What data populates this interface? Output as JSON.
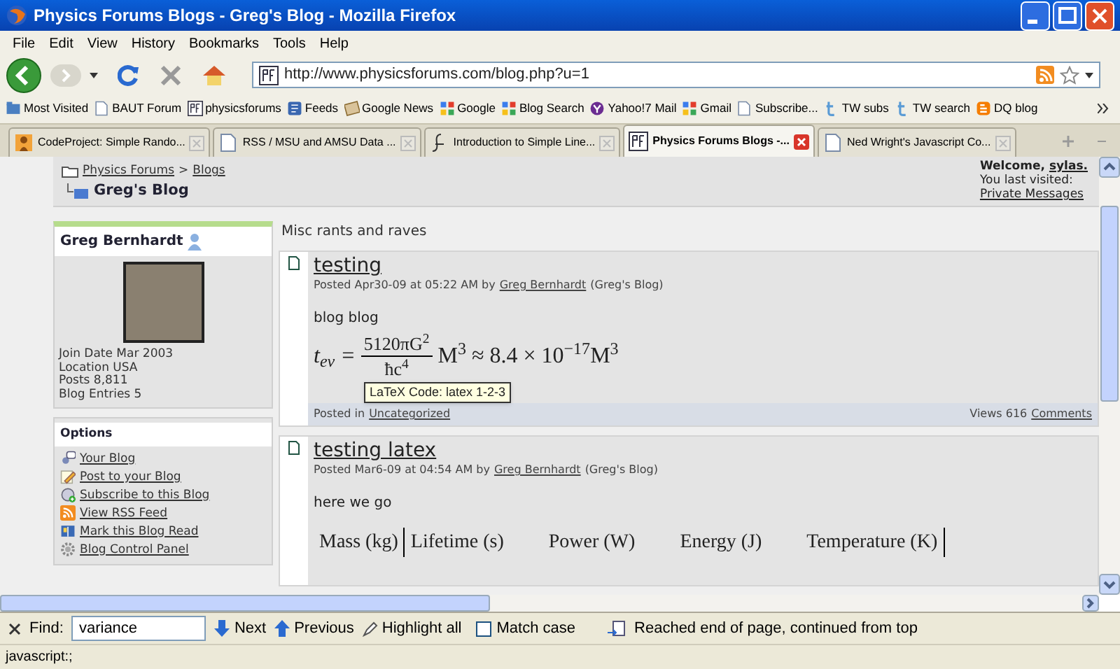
{
  "window": {
    "title": "Physics Forums Blogs - Greg's Blog - Mozilla Firefox"
  },
  "menu": [
    "File",
    "Edit",
    "View",
    "History",
    "Bookmarks",
    "Tools",
    "Help"
  ],
  "address": {
    "url": "http://www.physicsforums.com/blog.php?u=1"
  },
  "bookmarks": [
    {
      "label": "Most Visited",
      "kind": "folder"
    },
    {
      "label": "BAUT Forum",
      "kind": "page"
    },
    {
      "label": "physicsforums",
      "kind": "pf"
    },
    {
      "label": "Feeds",
      "kind": "feed"
    },
    {
      "label": "Google News",
      "kind": "news"
    },
    {
      "label": "Google",
      "kind": "google"
    },
    {
      "label": "Blog Search",
      "kind": "google"
    },
    {
      "label": "Yahoo!7 Mail",
      "kind": "yahoo"
    },
    {
      "label": "Gmail",
      "kind": "google"
    },
    {
      "label": "Subscribe...",
      "kind": "page"
    },
    {
      "label": "TW subs",
      "kind": "twitter"
    },
    {
      "label": "TW search",
      "kind": "twitter"
    },
    {
      "label": "DQ blog",
      "kind": "blogger"
    }
  ],
  "tabs": [
    {
      "label": "CodeProject: Simple Rando...",
      "selected": false,
      "kind": "codeproject"
    },
    {
      "label": "RSS / MSU and AMSU Data ...",
      "selected": false,
      "kind": "page"
    },
    {
      "label": "Introduction to Simple Line...",
      "selected": false,
      "kind": "script"
    },
    {
      "label": "Physics Forums Blogs -...",
      "selected": true,
      "kind": "pf"
    },
    {
      "label": "Ned Wright's Javascript Co...",
      "selected": false,
      "kind": "page"
    }
  ],
  "page": {
    "breadcrumb": {
      "root": "Physics Forums",
      "separator": ">",
      "section": "Blogs",
      "title": "Greg's Blog"
    },
    "welcome": {
      "label": "Welcome,",
      "user": "sylas.",
      "last_visited": "You last visited:",
      "private_messages": "Private Messages"
    },
    "profile": {
      "name": "Greg Bernhardt",
      "details": [
        "Join Date Mar 2003",
        "Location USA",
        "Posts 8,811",
        "Blog Entries 5"
      ]
    },
    "options": {
      "heading": "Options",
      "items": [
        {
          "label": "Your Blog",
          "kind": "blog"
        },
        {
          "label": "Post to your Blog",
          "kind": "pencil"
        },
        {
          "label": "Subscribe to this Blog",
          "kind": "subscribe"
        },
        {
          "label": "View RSS Feed",
          "kind": "rss"
        },
        {
          "label": "Mark this Blog Read",
          "kind": "book"
        },
        {
          "label": "Blog Control Panel",
          "kind": "gear"
        }
      ]
    },
    "description": "Misc rants and raves",
    "posts": [
      {
        "title": "testing",
        "posted": "Posted Apr30-09 at 05:22 AM by",
        "author": "Greg Bernhardt",
        "blog": "(Greg's Blog)",
        "body": "blog blog",
        "kind": "formula",
        "formula": {
          "lhs": "t$_{ev}$ =",
          "numerator": "5120πG$^{2}$",
          "denominator": "ħc$^{4}$",
          "rest": "M$^{3}$ ≈ 8.4 × 10$^{−17}$M$^{3}$"
        },
        "footer": {
          "label": "Posted in",
          "category": "Uncategorized",
          "views": "Views 616",
          "comments": "Comments"
        }
      },
      {
        "title": "testing latex",
        "posted": "Posted Mar6-09 at 04:54 AM by",
        "author": "Greg Bernhardt",
        "blog": "(Greg's Blog)",
        "body": "here we go",
        "kind": "table",
        "table": {
          "columns": [
            "Mass (kg)",
            "Lifetime (s)",
            "Power (W)",
            "Energy (J)",
            "Temperature (K)"
          ]
        }
      }
    ]
  },
  "tooltip": "LaTeX Code: latex 1-2-3",
  "find_bar": {
    "label": "Find:",
    "value": "variance",
    "next": "Next",
    "previous": "Previous",
    "highlight": "Highlight all",
    "match_case": {
      "label": "Match case",
      "checked": false
    },
    "message": "Reached end of page, continued from top"
  },
  "status_bar": "javascript:;"
}
